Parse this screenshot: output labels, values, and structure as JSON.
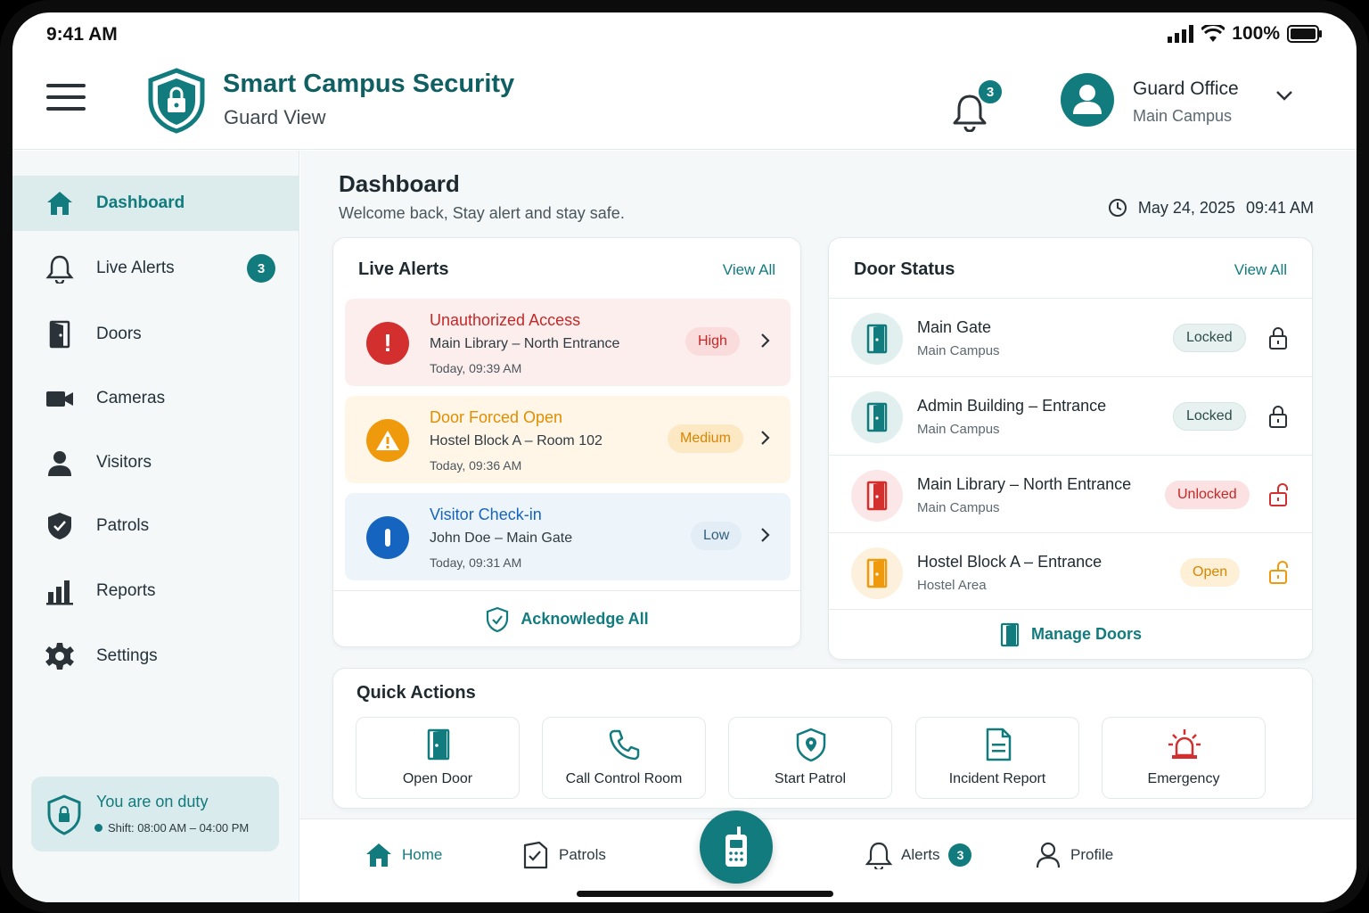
{
  "status_bar": {
    "time": "9:41 AM",
    "battery": "100%"
  },
  "header": {
    "title": "Smart Campus Security",
    "subtitle": "Guard View",
    "notification_count": "3",
    "profile_name": "Guard Office",
    "profile_location": "Main Campus"
  },
  "sidebar": {
    "items": [
      {
        "label": "Dashboard",
        "icon": "home-icon"
      },
      {
        "label": "Live Alerts",
        "icon": "bell-icon",
        "badge": "3"
      },
      {
        "label": "Doors",
        "icon": "door-icon"
      },
      {
        "label": "Cameras",
        "icon": "camera-icon"
      },
      {
        "label": "Visitors",
        "icon": "user-icon"
      },
      {
        "label": "Patrols",
        "icon": "patrol-shield-icon"
      },
      {
        "label": "Reports",
        "icon": "bar-chart-icon"
      },
      {
        "label": "Settings",
        "icon": "gear-icon"
      }
    ],
    "duty_title": "You are on duty",
    "duty_shift": "Shift: 08:00 AM – 04:00 PM"
  },
  "main": {
    "title": "Dashboard",
    "subtitle": "Welcome back, Stay alert and stay safe.",
    "date": "May 24, 2025",
    "time": "09:41 AM"
  },
  "live_alerts": {
    "title": "Live Alerts",
    "view_all": "View All",
    "items": [
      {
        "title": "Unauthorized Access",
        "location": "Main Library – North Entrance",
        "time": "Today, 09:39 AM",
        "severity": "High"
      },
      {
        "title": "Door Forced Open",
        "location": "Hostel Block A – Room 102",
        "time": "Today, 09:36 AM",
        "severity": "Medium"
      },
      {
        "title": "Visitor Check-in",
        "location": "John Doe – Main Gate",
        "time": "Today, 09:31 AM",
        "severity": "Low"
      }
    ],
    "acknowledge_all": "Acknowledge All"
  },
  "door_status": {
    "title": "Door Status",
    "view_all": "View All",
    "items": [
      {
        "name": "Main Gate",
        "location": "Main Campus",
        "status": "Locked"
      },
      {
        "name": "Admin Building – Entrance",
        "location": "Main Campus",
        "status": "Locked"
      },
      {
        "name": "Main Library – North Entrance",
        "location": "Main Campus",
        "status": "Unlocked"
      },
      {
        "name": "Hostel Block A – Entrance",
        "location": "Hostel Area",
        "status": "Open"
      }
    ],
    "manage": "Manage Doors"
  },
  "quick_actions": {
    "title": "Quick Actions",
    "items": [
      {
        "label": "Open Door",
        "icon": "door-icon"
      },
      {
        "label": "Call Control Room",
        "icon": "phone-icon"
      },
      {
        "label": "Start Patrol",
        "icon": "location-shield-icon"
      },
      {
        "label": "Incident Report",
        "icon": "document-icon"
      },
      {
        "label": "Emergency",
        "icon": "siren-icon"
      }
    ]
  },
  "bottom_nav": {
    "home": "Home",
    "patrols": "Patrols",
    "alerts": "Alerts",
    "alerts_badge": "3",
    "profile": "Profile"
  },
  "colors": {
    "brand": "#127b7e",
    "high": "#d32f2f",
    "medium": "#ef9a0c",
    "low": "#1565c0"
  }
}
